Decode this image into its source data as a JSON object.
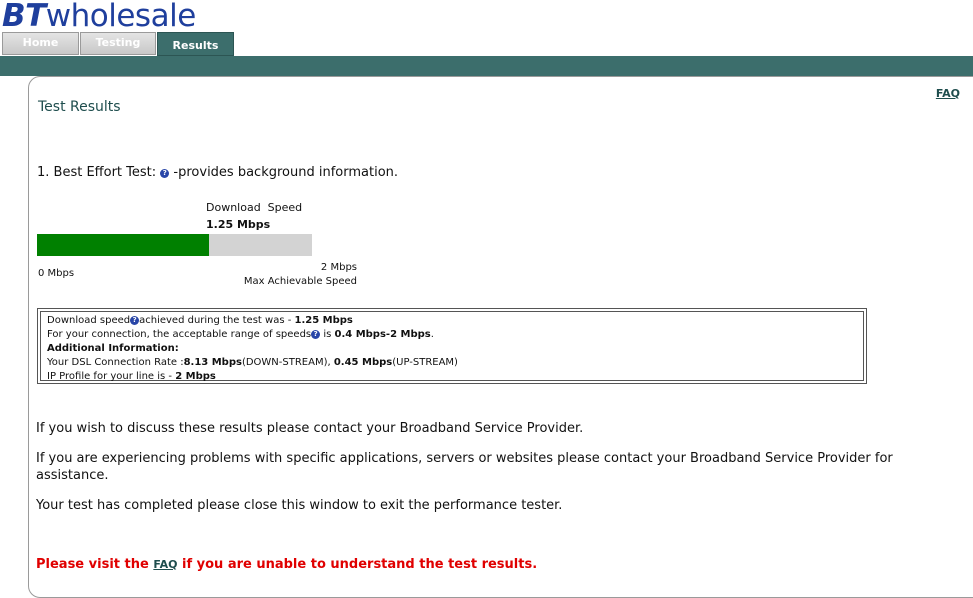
{
  "brand": {
    "bt": "BT",
    "wholesale": "wholesale"
  },
  "tabs": [
    {
      "label": "Home"
    },
    {
      "label": "Testing"
    },
    {
      "label": "Results"
    }
  ],
  "faq_link": "FAQ",
  "page_title": "Test Results",
  "best_effort": {
    "prefix": "1. Best Effort Test:",
    "icon": "question-icon",
    "suffix": "-provides background information."
  },
  "meter": {
    "download_label": "Download  Speed",
    "download_value": "1.25 Mbps",
    "min_label": "0 Mbps",
    "max_value": "2 Mbps",
    "max_caption": "Max Achievable Speed",
    "fill_fraction": 0.625,
    "fill_color": "#008000",
    "track_color": "#d3d3d3"
  },
  "info": {
    "line1_a": "Download speed",
    "line1_b": "achieved during the test was - ",
    "line1_val": "1.25 Mbps",
    "line2_a": "For your connection, the acceptable range of speeds",
    "line2_b": " is ",
    "line2_val": "0.4 Mbps-2 Mbps",
    "line2_end": ".",
    "additional_heading": "Additional Information:",
    "line4_a": "Your DSL Connection Rate :",
    "line4_down": "8.13 Mbps",
    "line4_down_tag": "(DOWN-STREAM), ",
    "line4_up": "0.45 Mbps",
    "line4_up_tag": "(UP-STREAM)",
    "line5_a": "IP Profile for your line is - ",
    "line5_val": "2 Mbps"
  },
  "paragraphs": {
    "p1": "If you wish to discuss these results please contact your Broadband Service Provider.",
    "p2": "If you are experiencing problems with specific applications, servers or websites please contact your Broadband Service Provider for assistance.",
    "p3": "Your test has completed please close this window to exit the performance tester."
  },
  "bottom": {
    "before": "Please visit the ",
    "link": "FAQ",
    "after": " if you are unable to understand the test results."
  },
  "colors": {
    "brand_blue": "#1f3f9d",
    "teal": "#3c6e6c",
    "alert_red": "#e00000"
  }
}
